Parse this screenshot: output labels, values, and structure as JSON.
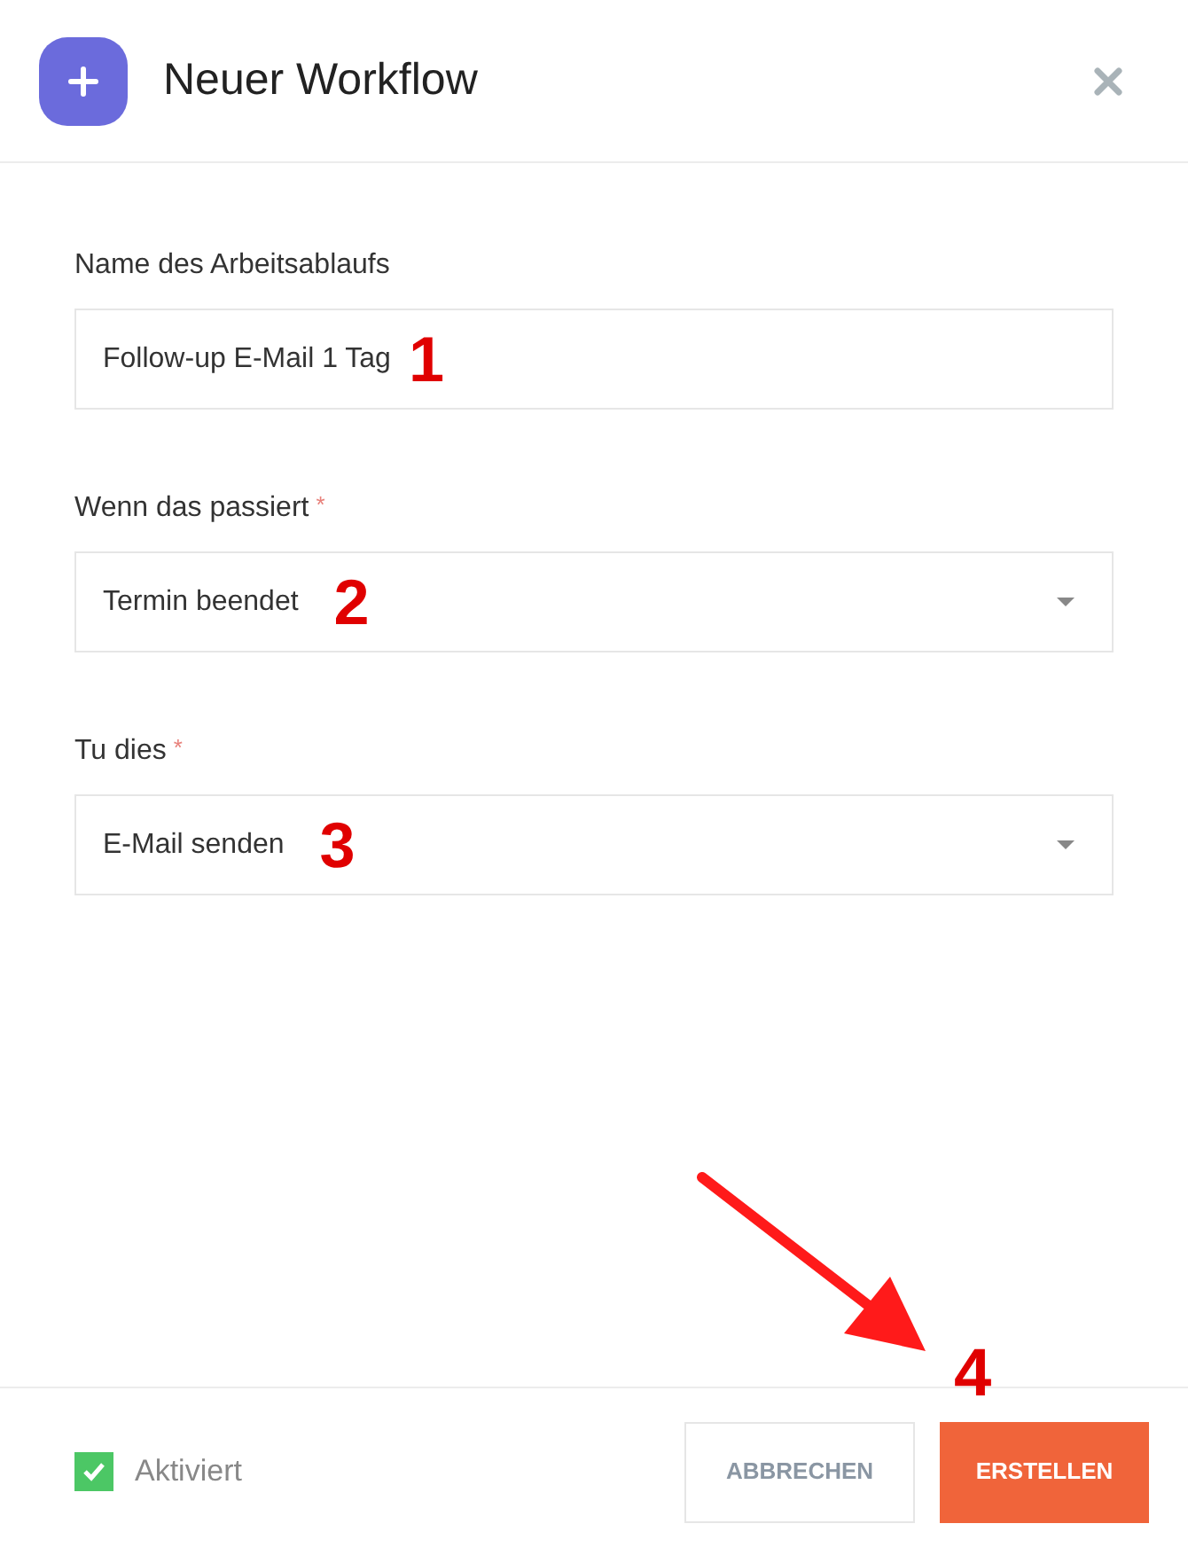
{
  "dialog": {
    "title": "Neuer Workflow"
  },
  "fields": [
    {
      "kind": "text",
      "label": "Name des Arbeitsablaufs",
      "value": "Follow-up E-Mail 1 Tag",
      "step": "1"
    },
    {
      "kind": "select",
      "label": "Wenn das passiert",
      "required_mark": "*",
      "value": "Termin beendet",
      "step": "2"
    },
    {
      "kind": "select",
      "label": "Tu dies",
      "required_mark": "*",
      "value": "E-Mail senden",
      "step": "3"
    }
  ],
  "footer": {
    "active": {
      "label": "Aktiviert",
      "checked": true
    },
    "buttons": [
      {
        "label": "ABBRECHEN",
        "kind": "secondary"
      },
      {
        "label": "ERSTELLEN",
        "kind": "primary",
        "step": "4"
      }
    ]
  }
}
